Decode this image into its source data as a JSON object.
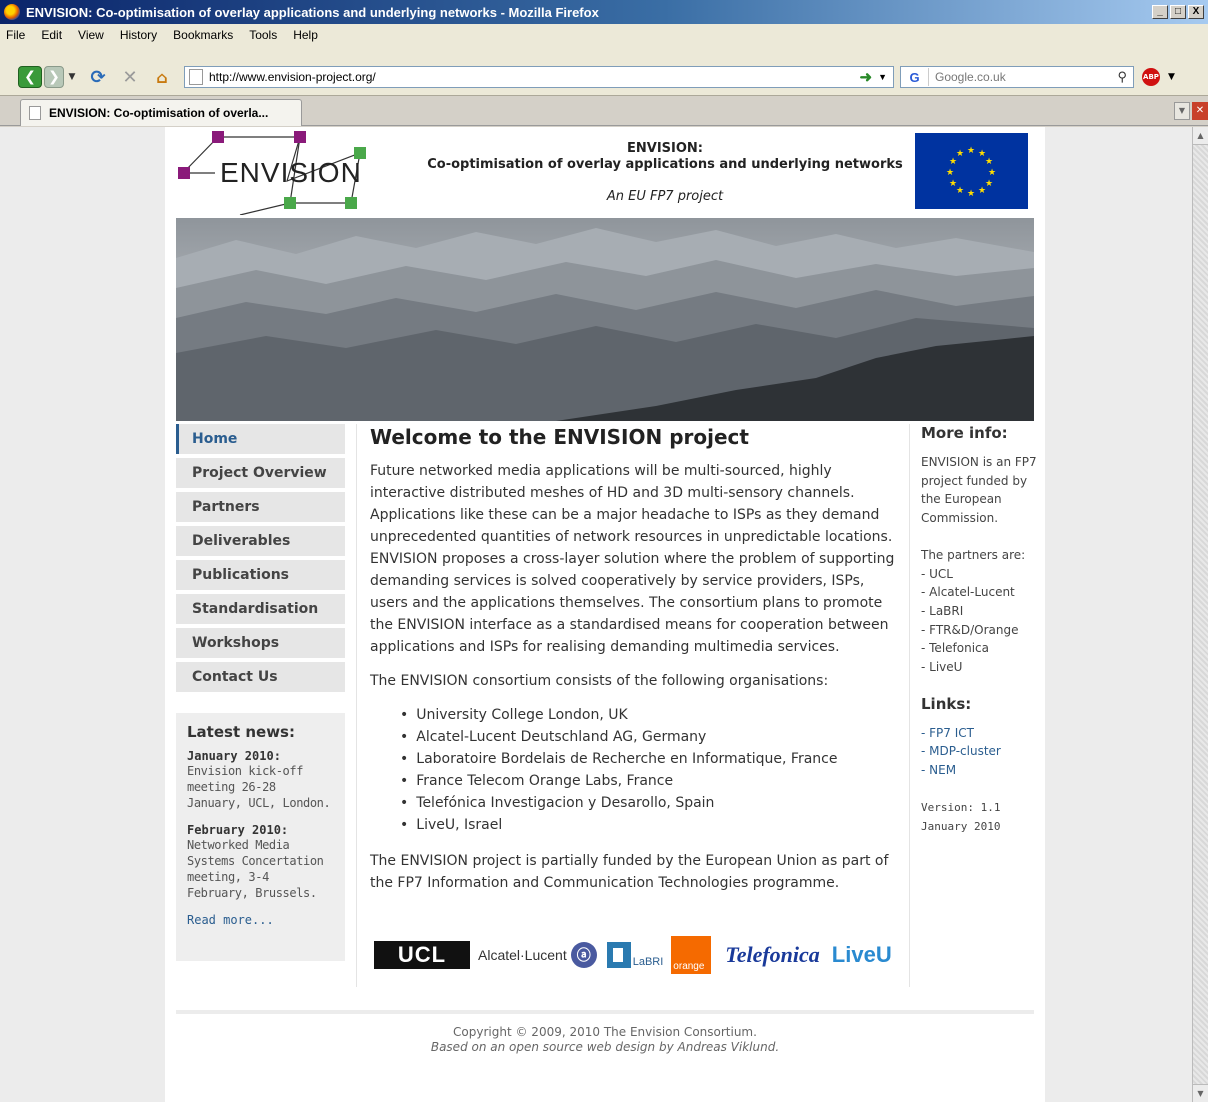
{
  "window": {
    "title": "ENVISION: Co-optimisation of overlay applications and underlying networks - Mozilla Firefox",
    "buttons": [
      "_",
      "□",
      "X"
    ]
  },
  "menu": [
    "File",
    "Edit",
    "View",
    "History",
    "Bookmarks",
    "Tools",
    "Help"
  ],
  "toolbar": {
    "url": "http://www.envision-project.org/",
    "search_engine": "G",
    "search_placeholder": "Google.co.uk",
    "abp_label": "ABP"
  },
  "tab": {
    "title": "ENVISION: Co-optimisation of overla..."
  },
  "header": {
    "logo_text": "ENVISION",
    "title": "ENVISION:",
    "subtitle": "Co-optimisation of overlay applications and underlying networks",
    "tagline": "An EU FP7 project"
  },
  "nav": [
    {
      "label": "Home",
      "active": true
    },
    {
      "label": "Project Overview"
    },
    {
      "label": "Partners"
    },
    {
      "label": "Deliverables"
    },
    {
      "label": "Publications"
    },
    {
      "label": "Standardisation"
    },
    {
      "label": "Workshops"
    },
    {
      "label": "Contact Us"
    }
  ],
  "news": {
    "heading": "Latest news:",
    "items": [
      {
        "date": "January 2010:",
        "body": "Envision kick-off meeting 26-28 January, UCL, London."
      },
      {
        "date": "February 2010:",
        "body": "Networked Media Systems Concertation meeting, 3-4 February, Brussels."
      }
    ],
    "more": "Read more..."
  },
  "main": {
    "title": "Welcome to the ENVISION project",
    "intro": "Future networked media applications will be multi-sourced, highly interactive distributed meshes of HD and 3D multi-sensory channels. Applications like these can be a major headache to ISPs as they demand unprecedented quantities of network resources in unpredictable locations. ENVISION proposes a cross-layer solution where the problem of supporting demanding services is solved cooperatively by service providers, ISPs, users and the applications themselves. The consortium plans to promote the ENVISION interface as a standardised means for cooperation between applications and ISPs for realising demanding multimedia services.",
    "consortium_intro": "The ENVISION consortium consists of the following organisations:",
    "organisations": [
      "University College London, UK",
      "Alcatel-Lucent Deutschland AG, Germany",
      "Laboratoire Bordelais de Recherche en Informatique, France",
      "France Telecom Orange Labs, France",
      "Telefónica Investigacion y Desarollo, Spain",
      "LiveU, Israel"
    ],
    "funding": "The ENVISION project is partially funded by the European Union as part of the FP7 Information and Communication Technologies programme.",
    "partner_logos": {
      "ucl": "UCL",
      "alcatel": "Alcatel·Lucent",
      "labri": "LaBRI",
      "orange": "orange",
      "telefonica": "Telefonica",
      "liveu": "LiveU"
    }
  },
  "sidebar": {
    "more_info_heading": "More info:",
    "more_info_text": "ENVISION is an FP7 project funded by the European Commission.",
    "partners_intro": "The partners are:",
    "partners": [
      "- UCL",
      "- Alcatel-Lucent",
      "- LaBRI",
      "- FTR&D/Orange",
      "- Telefonica",
      "- LiveU"
    ],
    "links_heading": "Links:",
    "links": [
      "- FP7 ICT",
      "- MDP-cluster",
      "- NEM"
    ],
    "version": "Version: 1.1",
    "version_date": "January 2010"
  },
  "footer": {
    "copyright": "Copyright © 2009, 2010 The Envision Consortium.",
    "credit": "Based on an open source web design by Andreas Viklund."
  }
}
